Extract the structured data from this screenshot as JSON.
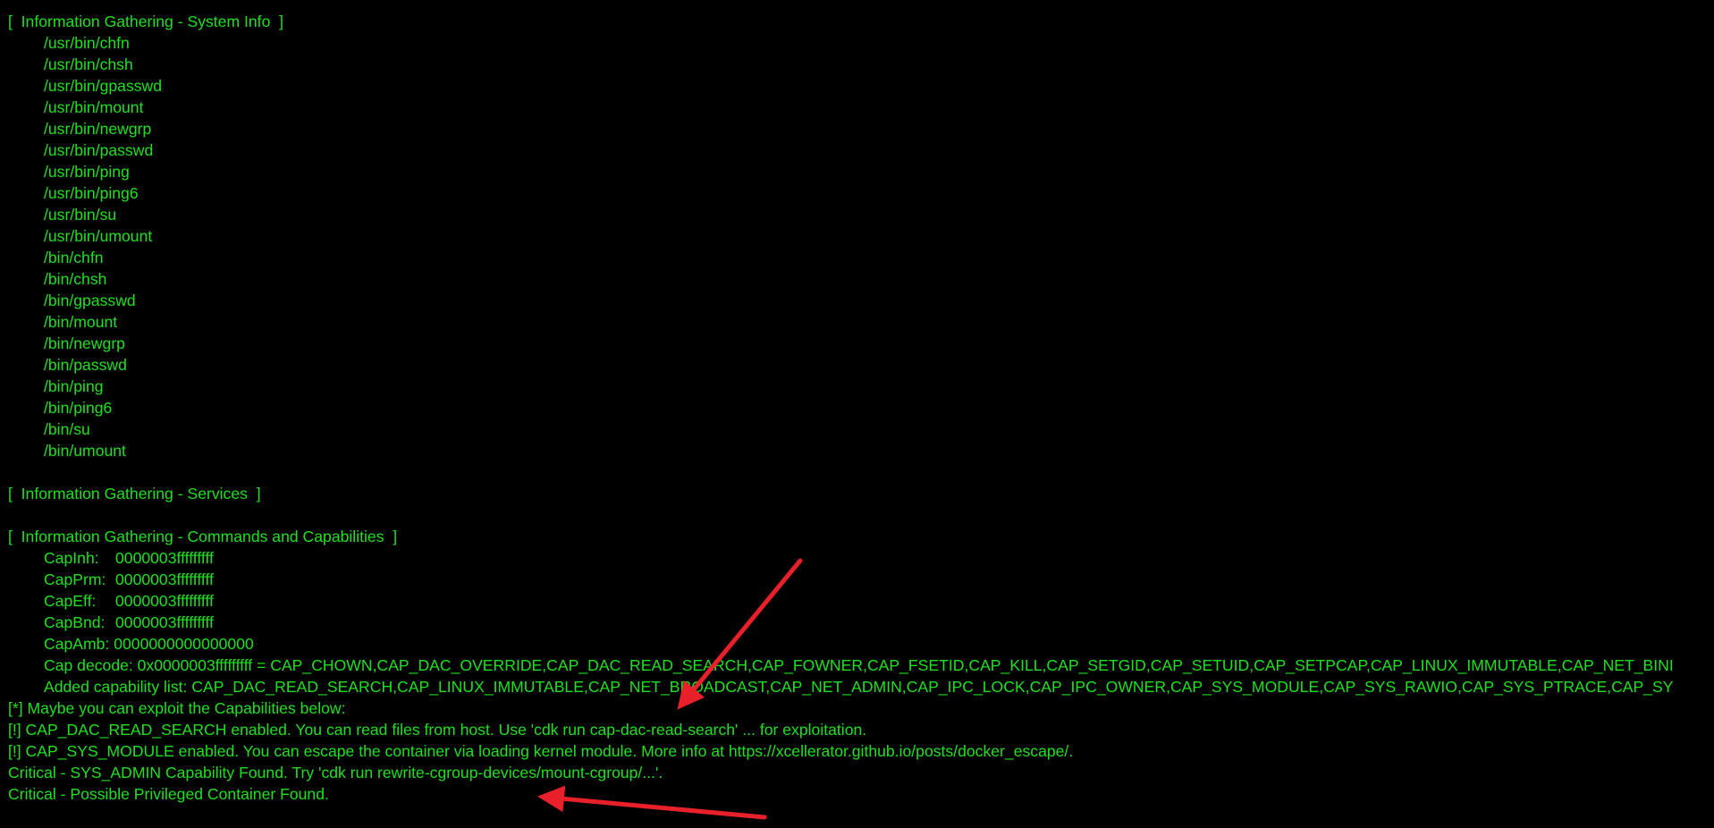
{
  "system_info": {
    "header": "[  Information Gathering - System Info  ]",
    "paths": [
      "/usr/bin/chfn",
      "/usr/bin/chsh",
      "/usr/bin/gpasswd",
      "/usr/bin/mount",
      "/usr/bin/newgrp",
      "/usr/bin/passwd",
      "/usr/bin/ping",
      "/usr/bin/ping6",
      "/usr/bin/su",
      "/usr/bin/umount",
      "/bin/chfn",
      "/bin/chsh",
      "/bin/gpasswd",
      "/bin/mount",
      "/bin/newgrp",
      "/bin/passwd",
      "/bin/ping",
      "/bin/ping6",
      "/bin/su",
      "/bin/umount"
    ]
  },
  "services": {
    "header": "[  Information Gathering - Services  ]"
  },
  "capabilities": {
    "header": "[  Information Gathering - Commands and Capabilities  ]",
    "rows": [
      {
        "label": "CapInh:",
        "value": "0000003fffffffff"
      },
      {
        "label": "CapPrm:",
        "value": "0000003fffffffff"
      },
      {
        "label": "CapEff:",
        "value": "0000003fffffffff"
      },
      {
        "label": "CapBnd:",
        "value": "0000003fffffffff"
      },
      {
        "label": "CapAmb:",
        "value": "0000000000000000"
      }
    ],
    "cap_decode": "Cap decode: 0x0000003fffffffff = CAP_CHOWN,CAP_DAC_OVERRIDE,CAP_DAC_READ_SEARCH,CAP_FOWNER,CAP_FSETID,CAP_KILL,CAP_SETGID,CAP_SETUID,CAP_SETPCAP,CAP_LINUX_IMMUTABLE,CAP_NET_BINI",
    "added_list": "Added capability list: CAP_DAC_READ_SEARCH,CAP_LINUX_IMMUTABLE,CAP_NET_BROADCAST,CAP_NET_ADMIN,CAP_IPC_LOCK,CAP_IPC_OWNER,CAP_SYS_MODULE,CAP_SYS_RAWIO,CAP_SYS_PTRACE,CAP_SY"
  },
  "findings": [
    "[*] Maybe you can exploit the Capabilities below:",
    "[!] CAP_DAC_READ_SEARCH enabled. You can read files from host. Use 'cdk run cap-dac-read-search' ... for exploitation.",
    "[!] CAP_SYS_MODULE enabled. You can escape the container via loading kernel module. More info at https://xcellerator.github.io/posts/docker_escape/.",
    "Critical - SYS_ADMIN Capability Found. Try 'cdk run rewrite-cgroup-devices/mount-cgroup/...'.",
    "Critical - Possible Privileged Container Found."
  ],
  "colors": {
    "background": "#000000",
    "text": "#1fe01f",
    "annotation_arrow": "#e8202a"
  }
}
